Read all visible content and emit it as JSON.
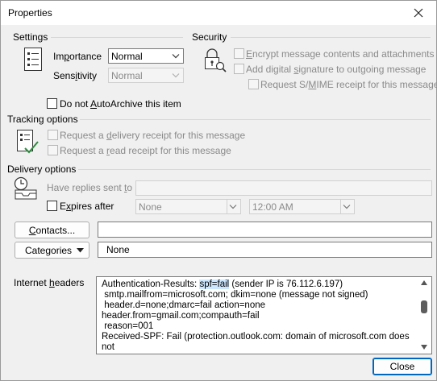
{
  "window": {
    "title": "Properties"
  },
  "settings": {
    "group_label": "Settings",
    "importance": {
      "label_pre": "Im",
      "label_acc": "p",
      "label_post": "ortance",
      "value": "Normal"
    },
    "sensitivity": {
      "label_pre": "Sens",
      "label_acc": "i",
      "label_post": "tivity",
      "value": "Normal"
    },
    "autoarchive": {
      "label_pre": "Do not ",
      "label_acc": "A",
      "label_post": "utoArchive this item",
      "checked": false
    }
  },
  "security": {
    "group_label": "Security",
    "encrypt": {
      "label_pre": "",
      "label_acc": "E",
      "label_post": "ncrypt message contents and attachments"
    },
    "signature": {
      "label_pre": "Add digital ",
      "label_acc": "s",
      "label_post": "ignature to outgoing message"
    },
    "smime": {
      "label_pre": "Request S/",
      "label_acc": "M",
      "label_post": "IME receipt for this message"
    }
  },
  "tracking": {
    "group_label": "Tracking options",
    "delivery": {
      "label_pre": "Request a ",
      "label_acc": "d",
      "label_post": "elivery receipt for this message"
    },
    "read": {
      "label_pre": "Request a ",
      "label_acc": "r",
      "label_post": "ead receipt for this message"
    }
  },
  "delivery": {
    "group_label": "Delivery options",
    "replies": {
      "label_pre": "Have replies sent ",
      "label_acc": "t",
      "label_post": "o"
    },
    "expires": {
      "label_pre": "E",
      "label_acc": "x",
      "label_post": "pires after",
      "date": "None",
      "time": "12:00 AM"
    }
  },
  "contacts": {
    "button_pre": "",
    "button_acc": "C",
    "button_post": "ontacts...",
    "value": ""
  },
  "categories": {
    "button_pre": "Cate",
    "button_acc": "g",
    "button_post": "ories",
    "value": "None"
  },
  "internet_headers": {
    "label_pre": "Internet ",
    "label_acc": "h",
    "label_post": "eaders",
    "line1_pre": "Authentication-Results: ",
    "line1_hl": "spf=fail",
    "line1_post": " (sender IP is 76.112.6.197)",
    "rest": " smtp.mailfrom=microsoft.com; dkim=none (message not signed)\n header.d=none;dmarc=fail action=none\nheader.from=gmail.com;compauth=fail\n reason=001\nReceived-SPF: Fail (protection.outlook.com: domain of microsoft.com does\nnot"
  },
  "footer": {
    "close_label": "Close"
  }
}
